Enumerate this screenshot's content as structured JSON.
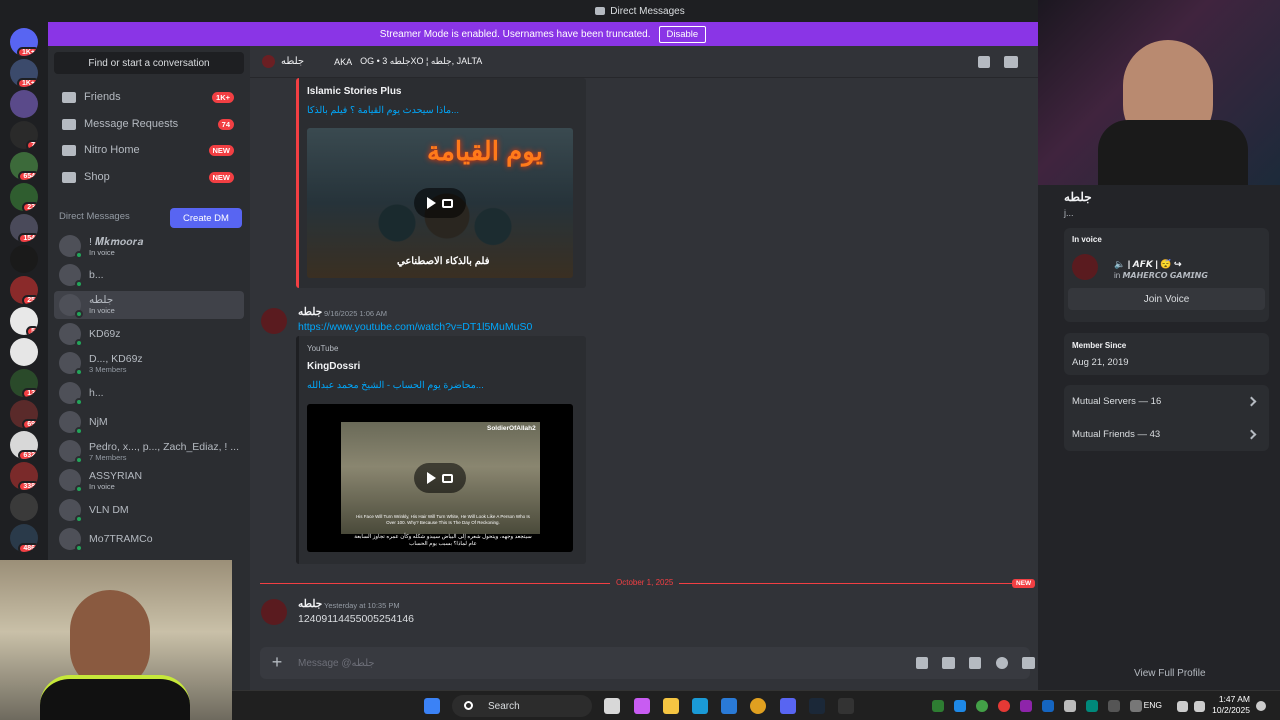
{
  "window": {
    "title": "Direct Messages"
  },
  "banner": {
    "text": "Streamer Mode is enabled. Usernames have been truncated.",
    "action": "Disable"
  },
  "guilds": [
    {
      "badge": "1K+",
      "color": "#5865f2"
    },
    {
      "badge": "1K+",
      "color": "#3b4a6b"
    },
    {
      "badge": "",
      "color": "#5a4a8a"
    },
    {
      "badge": "7",
      "color": "#2a2a2a"
    },
    {
      "badge": "654",
      "color": "#3c6a3a"
    },
    {
      "badge": "23",
      "color": "#2f5d2f"
    },
    {
      "badge": "154",
      "color": "#4a4a5a"
    },
    {
      "badge": "",
      "color": "#1a1a1a"
    },
    {
      "badge": "25",
      "color": "#8a2a2a"
    },
    {
      "badge": "5",
      "color": "#e8e8e8"
    },
    {
      "badge": "",
      "color": "#e6e6e6"
    },
    {
      "badge": "13",
      "color": "#2a4a2a"
    },
    {
      "badge": "69",
      "color": "#5a2a2a"
    },
    {
      "badge": "632",
      "color": "#d8d8d8"
    },
    {
      "badge": "338",
      "color": "#7a2a2a"
    },
    {
      "badge": "",
      "color": "#3a3a3a"
    },
    {
      "badge": "486",
      "color": "#2a3a4a"
    }
  ],
  "dm_sidebar": {
    "search_placeholder": "Find or start a conversation",
    "nav": [
      {
        "label": "Friends",
        "badge": "1K+"
      },
      {
        "label": "Message Requests",
        "badge": "74"
      },
      {
        "label": "Nitro Home",
        "badge": "NEW"
      },
      {
        "label": "Shop",
        "badge": "NEW"
      }
    ],
    "header": "Direct Messages",
    "create_dm": "Create DM",
    "conversations": [
      {
        "name": "! 𝑴𝒌𝒎𝒐𝒐𝒓𝒂",
        "sub": "In voice",
        "voice": true
      },
      {
        "name": "b...",
        "sub": "",
        "voice": false
      },
      {
        "name": "جلطه",
        "sub": "In voice",
        "voice": true
      },
      {
        "name": "KD69z",
        "sub": "",
        "voice": false
      },
      {
        "name": "D..., KD69z",
        "sub": "3 Members",
        "voice": false
      },
      {
        "name": "h...",
        "sub": "",
        "voice": false
      },
      {
        "name": "NjM",
        "sub": "",
        "voice": false
      },
      {
        "name": "Pedro, x..., p..., Zach_Ediaz, ! ...",
        "sub": "7 Members",
        "voice": false
      },
      {
        "name": "ASSYRIAN",
        "sub": "In voice",
        "voice": true
      },
      {
        "name": "VLN DM",
        "sub": "",
        "voice": false
      },
      {
        "name": "Mo7TRAMCo",
        "sub": "",
        "voice": false
      }
    ]
  },
  "chat": {
    "header_name": "جلطه",
    "header_aka": "AKA",
    "header_aka_names": "OG • 3 جلطهXO ¦ جلطه, JALTA",
    "embed1": {
      "author": "Islamic Stories Plus",
      "title": "ماذا سيحدث يوم القيامة ؟ فيلم بالذكا...",
      "thumb_title": "يوم القيامة",
      "thumb_caption": "فلم بالذكاء الاصطناعي"
    },
    "msg1": {
      "author": "جلطه",
      "time": "9/16/2025 1:06 AM",
      "link": "https://www.youtube.com/watch?v=DT1l5MuMuS0"
    },
    "embed2": {
      "provider": "YouTube",
      "author": "KingDossri",
      "title": "محاضرة يوم الحساب - الشيخ محمد عبدالله...",
      "thumb_channel": "SoldierOfAllah2",
      "thumb_en": "His Face Will Turn Wrinkly, His Hair Will Turn White, He Will Look Like A Person Who Is Over 100. Why? Because This Is The Day Of Reckoning.",
      "thumb_ar": "سيتجعد وجهه، ويتحول شعره إلى البياض سيبدو شكله وكأن عمره تجاوز السابعة عام لماذا؟ بسبب يوم الحساب"
    },
    "divider_label": "October 1, 2025",
    "divider_badge": "NEW",
    "msg2": {
      "author": "جلطه",
      "time": "Yesterday at 10:35 PM",
      "text": "1240911445500525414​6"
    },
    "composer_placeholder": "Message @جلطه"
  },
  "profile": {
    "name": "جلطه",
    "status": "j...",
    "in_voice_label": "In voice",
    "voice_channel": "🔈 | 𝘼𝙁𝙆 | 😴 ↪",
    "voice_server": "in 𝙈𝘼𝙃𝙀𝙍𝘾𝙊 𝙂𝘼𝙈𝙄𝙉𝙂",
    "join_voice": "Join Voice",
    "member_since_label": "Member Since",
    "member_since": "Aug 21, 2019",
    "mutual_servers": "Mutual Servers — 16",
    "mutual_friends": "Mutual Friends — 43",
    "view_full": "View Full Profile"
  },
  "taskbar": {
    "search": "Search",
    "lang": "ENG",
    "time": "1:47 AM",
    "date": "10/2/2025"
  },
  "colors": {
    "blurple": "#5865f2",
    "streamer_banner": "#8a35e6",
    "red": "#f23f43",
    "link": "#00a8fc",
    "online": "#23a55a"
  }
}
